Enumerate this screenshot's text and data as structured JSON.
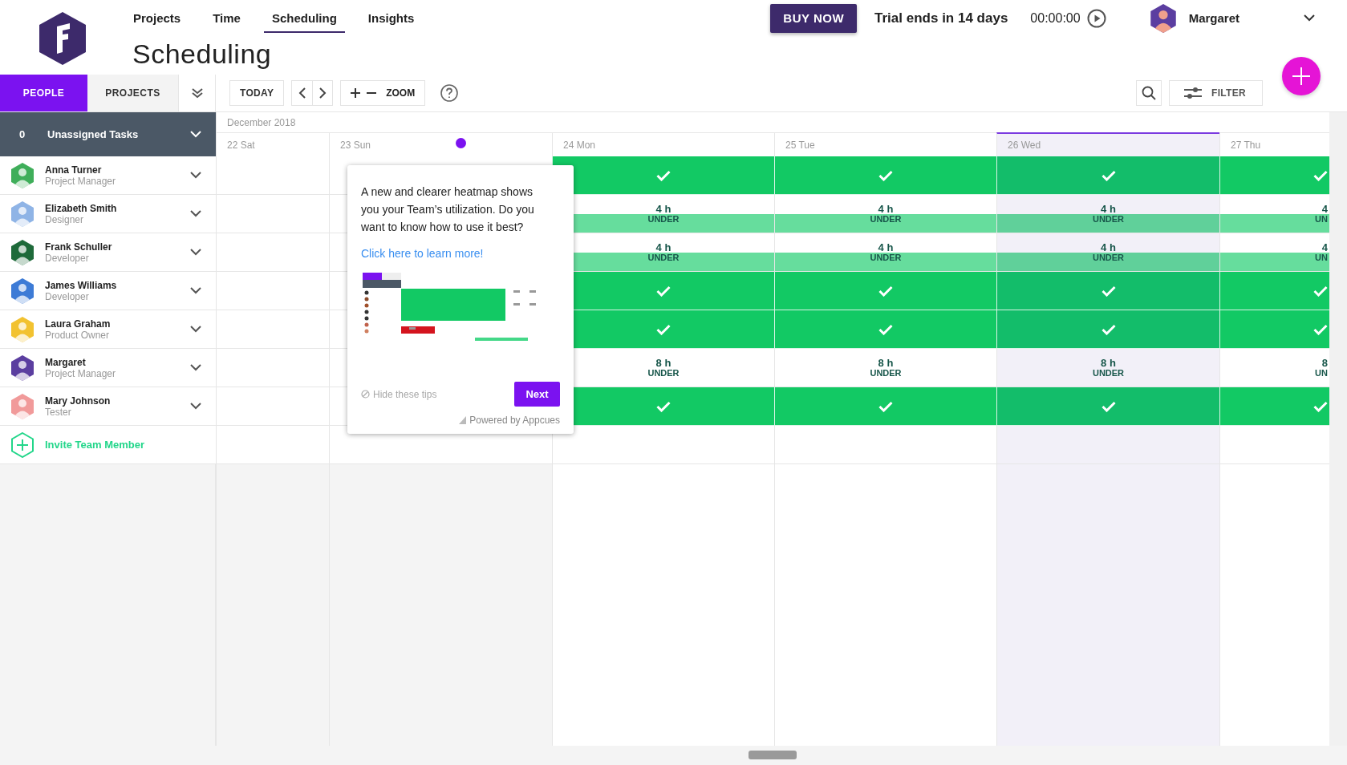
{
  "nav": {
    "tabs": [
      {
        "label": "Projects",
        "selected": false
      },
      {
        "label": "Time",
        "selected": false
      },
      {
        "label": "Scheduling",
        "selected": true
      },
      {
        "label": "Insights",
        "selected": false
      }
    ]
  },
  "page_title": "Scheduling",
  "header": {
    "buy_button": "BUY NOW",
    "trial": "Trial ends in 14 days",
    "timer": "00:00:00",
    "user": {
      "name": "Margaret",
      "color": "#5b3ea0"
    }
  },
  "view_tabs": [
    {
      "label": "PEOPLE",
      "selected": true
    },
    {
      "label": "PROJECTS",
      "selected": false
    }
  ],
  "toolbar": {
    "today": "TODAY",
    "zoom": "ZOOM",
    "filter": "FILTER"
  },
  "unassigned": {
    "count": "0",
    "label": "Unassigned Tasks"
  },
  "calendar": {
    "month": "December 2018",
    "days": [
      {
        "label": "22 Sat",
        "kind": "weekend",
        "current": false
      },
      {
        "label": "23 Sun",
        "kind": "weekend",
        "current": false
      },
      {
        "label": "24 Mon",
        "kind": "weekday",
        "current": false
      },
      {
        "label": "25 Tue",
        "kind": "weekday",
        "current": false
      },
      {
        "label": "26 Wed",
        "kind": "weekday",
        "current": true
      },
      {
        "label": "27 Thu",
        "kind": "weekday",
        "current": false
      }
    ]
  },
  "people": [
    {
      "name": "Anna Turner",
      "role": "Project Manager",
      "color": "#3fae5a",
      "cells": [
        {
          "kind": "empty"
        },
        {
          "kind": "empty"
        },
        {
          "kind": "full"
        },
        {
          "kind": "full"
        },
        {
          "kind": "full"
        },
        {
          "kind": "full"
        }
      ]
    },
    {
      "name": "Elizabeth Smith",
      "role": "Designer",
      "color": "#8fb4e6",
      "cells": [
        {
          "kind": "empty"
        },
        {
          "kind": "empty"
        },
        {
          "kind": "under",
          "hours": "4 h",
          "status": "UNDER",
          "scheduled": true
        },
        {
          "kind": "under",
          "hours": "4 h",
          "status": "UNDER",
          "scheduled": true
        },
        {
          "kind": "under",
          "hours": "4 h",
          "status": "UNDER",
          "scheduled": true
        },
        {
          "kind": "under",
          "hours": "4",
          "status": "UN",
          "scheduled": true
        }
      ]
    },
    {
      "name": "Frank Schuller",
      "role": "Developer",
      "color": "#1e6a3a",
      "cells": [
        {
          "kind": "empty"
        },
        {
          "kind": "empty"
        },
        {
          "kind": "under",
          "hours": "4 h",
          "status": "UNDER",
          "scheduled": true
        },
        {
          "kind": "under",
          "hours": "4 h",
          "status": "UNDER",
          "scheduled": true
        },
        {
          "kind": "under",
          "hours": "4 h",
          "status": "UNDER",
          "scheduled": true
        },
        {
          "kind": "under",
          "hours": "4",
          "status": "UN",
          "scheduled": true
        }
      ]
    },
    {
      "name": "James Williams",
      "role": "Developer",
      "color": "#3d7bd6",
      "cells": [
        {
          "kind": "empty"
        },
        {
          "kind": "empty"
        },
        {
          "kind": "full"
        },
        {
          "kind": "full"
        },
        {
          "kind": "full"
        },
        {
          "kind": "full"
        }
      ]
    },
    {
      "name": "Laura Graham",
      "role": "Product Owner",
      "color": "#f2c230",
      "cells": [
        {
          "kind": "empty"
        },
        {
          "kind": "empty"
        },
        {
          "kind": "full"
        },
        {
          "kind": "full"
        },
        {
          "kind": "full"
        },
        {
          "kind": "full"
        }
      ]
    },
    {
      "name": "Margaret",
      "role": "Project Manager",
      "color": "#5b3ea0",
      "cells": [
        {
          "kind": "empty"
        },
        {
          "kind": "empty"
        },
        {
          "kind": "under",
          "hours": "8 h",
          "status": "UNDER",
          "scheduled": false
        },
        {
          "kind": "under",
          "hours": "8 h",
          "status": "UNDER",
          "scheduled": false
        },
        {
          "kind": "under",
          "hours": "8 h",
          "status": "UNDER",
          "scheduled": false
        },
        {
          "kind": "under",
          "hours": "8",
          "status": "UN",
          "scheduled": false
        }
      ]
    },
    {
      "name": "Mary Johnson",
      "role": "Tester",
      "color": "#f19a9a",
      "cells": [
        {
          "kind": "empty"
        },
        {
          "kind": "empty"
        },
        {
          "kind": "full"
        },
        {
          "kind": "full"
        },
        {
          "kind": "full"
        },
        {
          "kind": "full"
        }
      ]
    }
  ],
  "invite": "Invite Team Member",
  "tip": {
    "text": "A new and clearer heatmap shows you your Team’s utilization. Do you want to know how to use it best?",
    "link": "Click here to learn more!",
    "hide": "Hide these tips",
    "next": "Next",
    "powered": "Powered by Appcues"
  }
}
